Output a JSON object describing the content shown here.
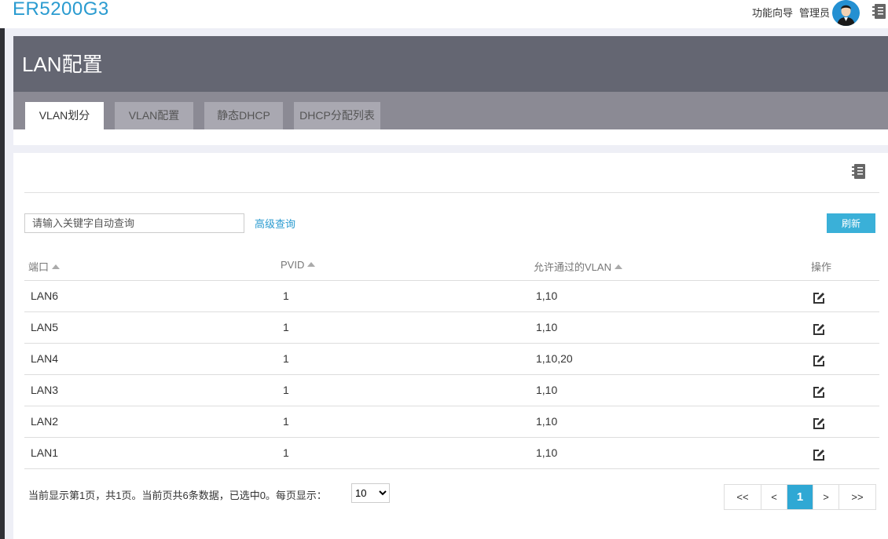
{
  "app": {
    "brand": "ER5200G3"
  },
  "topbar": {
    "wizard_label": "功能向导",
    "admin_label": "管理员"
  },
  "page": {
    "title": "LAN配置"
  },
  "tabs": [
    {
      "label": "VLAN划分",
      "active": true
    },
    {
      "label": "VLAN配置",
      "active": false
    },
    {
      "label": "静态DHCP",
      "active": false
    },
    {
      "label": "DHCP分配列表",
      "active": false
    }
  ],
  "search": {
    "placeholder": "请输入关键字自动查询",
    "value": "",
    "advanced_label": "高级查询"
  },
  "toolbar": {
    "refresh_label": "刷新"
  },
  "table": {
    "headers": [
      "端口",
      "PVID",
      "允许通过的VLAN",
      "操作"
    ],
    "rows": [
      {
        "port": "LAN6",
        "pvid": "1",
        "vlans": "1,10"
      },
      {
        "port": "LAN5",
        "pvid": "1",
        "vlans": "1,10"
      },
      {
        "port": "LAN4",
        "pvid": "1",
        "vlans": "1,10,20"
      },
      {
        "port": "LAN3",
        "pvid": "1",
        "vlans": "1,10"
      },
      {
        "port": "LAN2",
        "pvid": "1",
        "vlans": "1,10"
      },
      {
        "port": "LAN1",
        "pvid": "1",
        "vlans": "1,10"
      }
    ]
  },
  "footer": {
    "status_text": "当前显示第1页，共1页。当前页共6条数据，已选中0。每页显示：",
    "page_size": "10"
  },
  "pagination": {
    "first": "<<",
    "prev": "<",
    "current": "1",
    "next": ">",
    "last": ">>"
  },
  "colors": {
    "brand": "#2a9bd0",
    "accent": "#3ab0d8",
    "header_bg": "#646672"
  },
  "icons": {
    "avatar": "user-avatar",
    "doc": "notebook-icon",
    "edit": "edit-icon"
  }
}
